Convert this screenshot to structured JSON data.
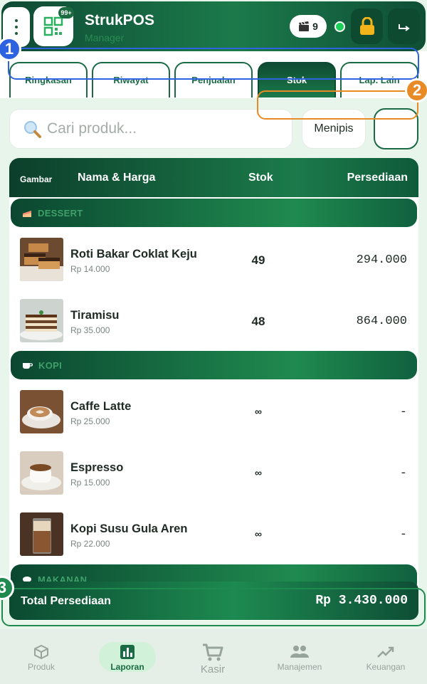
{
  "header": {
    "title": "StrukPOS",
    "role": "Manager",
    "notif_badge": "99+",
    "clap_count": "9"
  },
  "tabs": [
    {
      "label": "Ringkasan",
      "active": false
    },
    {
      "label": "Riwayat",
      "active": false
    },
    {
      "label": "Penjualan",
      "active": false
    },
    {
      "label": "Stok",
      "active": true
    },
    {
      "label": "Lap. Lain",
      "active": false
    }
  ],
  "search": {
    "placeholder": "Cari produk...",
    "filter_label": "Menipis"
  },
  "table": {
    "headers": {
      "image": "Gambar",
      "name_price": "Nama & Harga",
      "stock": "Stok",
      "inventory": "Persediaan"
    },
    "categories": [
      {
        "name": "DESSERT",
        "icon": "cake-icon",
        "items": [
          {
            "name": "Roti Bakar Coklat Keju",
            "price": "Rp 14.000",
            "stock": "49",
            "inventory": "294.000"
          },
          {
            "name": "Tiramisu",
            "price": "Rp 35.000",
            "stock": "48",
            "inventory": "864.000"
          }
        ]
      },
      {
        "name": "KOPI",
        "icon": "coffee-icon",
        "items": [
          {
            "name": "Caffe Latte",
            "price": "Rp 25.000",
            "stock": "∞",
            "inventory": "-"
          },
          {
            "name": "Espresso",
            "price": "Rp 15.000",
            "stock": "∞",
            "inventory": "-"
          },
          {
            "name": "Kopi Susu Gula Aren",
            "price": "Rp 22.000",
            "stock": "∞",
            "inventory": "-"
          }
        ]
      },
      {
        "name": "MAKANAN",
        "icon": "plate-icon",
        "items": []
      }
    ]
  },
  "total": {
    "label": "Total Persediaan",
    "value": "Rp 3.430.000"
  },
  "bottom_nav": [
    {
      "label": "Produk",
      "icon": "box-icon",
      "active": false
    },
    {
      "label": "Laporan",
      "icon": "chart-icon",
      "active": true
    },
    {
      "label": "Kasir",
      "icon": "cart-icon",
      "active": false
    },
    {
      "label": "Manajemen",
      "icon": "people-icon",
      "active": false
    },
    {
      "label": "Keuangan",
      "icon": "trend-icon",
      "active": false
    }
  ],
  "annotations": [
    "1",
    "2",
    "3"
  ],
  "colors": {
    "primary_dark": "#0f4a34",
    "primary": "#1b7a4a",
    "annotation_blue": "#2d62e0",
    "annotation_orange": "#e88a25",
    "annotation_green": "#1f8a4f"
  }
}
